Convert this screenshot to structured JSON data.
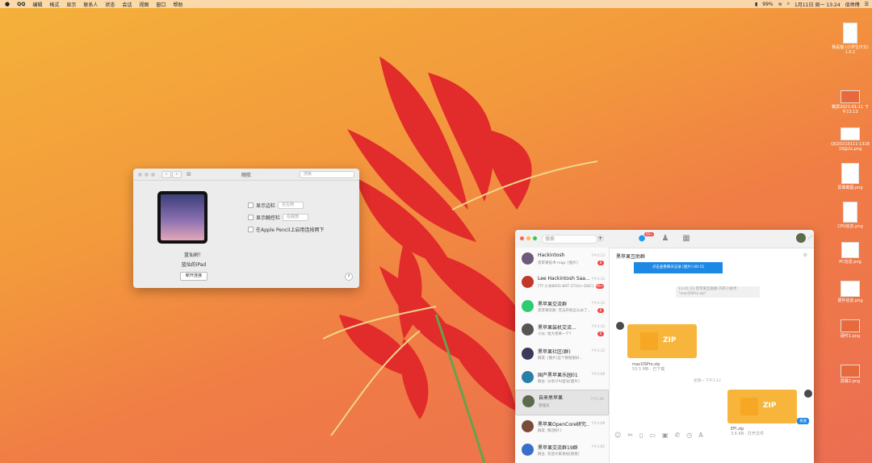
{
  "menubar": {
    "app": "QQ",
    "items": [
      "编辑",
      "格式",
      "显示",
      "联系人",
      "状态",
      "会话",
      "视图",
      "窗口",
      "帮助"
    ],
    "battery": "99%",
    "datetime": "1月11日 周一 13:24",
    "user": "佰师傅"
  },
  "desktop_icons": [
    {
      "label": "我是猫 (小学生作文) 1.0.1"
    },
    {
      "label": "截屏2021-01-11 下午13.13"
    },
    {
      "label": "QQ20210111-1318 19@2x.png"
    },
    {
      "label": "屏幕截图.png"
    },
    {
      "label": "CPU信息.png"
    },
    {
      "label": "PC信息.png"
    },
    {
      "label": "硬件信息.png"
    },
    {
      "label": "硬件1.png"
    },
    {
      "label": "屏幕2.png"
    }
  ],
  "prefs": {
    "title": "随航",
    "search_placeholder": "搜索",
    "device_line1": "蓝仙树！",
    "device_line2": "蓝仙的iPad",
    "disconnect_label": "断开连接",
    "options": [
      {
        "label": "显示边栏",
        "value": "在左侧"
      },
      {
        "label": "显示触控栏",
        "value": "在底部"
      },
      {
        "label": "在Apple Pencil上启用连按两下"
      }
    ],
    "help": "?"
  },
  "qq": {
    "search_placeholder": "搜索",
    "plus": "+",
    "badge": "99+",
    "contacts": [
      {
        "name": "Hackintosh",
        "preview": "黑苹果技术-mqp: [图片]",
        "time": "下午1:13",
        "badge": "8",
        "color": "#6d5a7a"
      },
      {
        "name": "Lee Hackintosh Saa...",
        "preview": "[TF·小米8001·B0T·3710+·DOC]...",
        "time": "下午1:12",
        "badge": "99+",
        "color": "#c0392b"
      },
      {
        "name": "黑苹果交流群",
        "preview": "黑苹果玩家: 无法开机怎么办了...",
        "time": "下午1:12",
        "badge": "8",
        "color": "#2ecc71"
      },
      {
        "name": "黑苹果装机交流...",
        "preview": "小伙: 给大佬来一个?",
        "time": "下午1:12",
        "badge": "6",
        "color": "#555555"
      },
      {
        "name": "黑苹果社区(群)",
        "preview": "群友: [图片]这个教程很好...",
        "time": "下午1:12",
        "badge": "",
        "color": "#3a3a5a"
      },
      {
        "name": "国产黑苹果乐园01",
        "preview": "群主: 分享CPU型号[图片]",
        "time": "下午1:09",
        "badge": "",
        "color": "#2a7fa8"
      },
      {
        "name": "自来黑苹果",
        "preview": "管理员",
        "time": "下午1:09",
        "badge": "",
        "color": "#5b6b4b"
      },
      {
        "name": "黑苹果OpenCore研究...",
        "preview": "群友: 嗯[图片]",
        "time": "下午1:08",
        "badge": "",
        "color": "#7a4b3a"
      },
      {
        "name": "黑苹果交流群19群",
        "preview": "群主: 欢迎大家发帖[链接]",
        "time": "下午1:05",
        "badge": "",
        "color": "#3a6fc8"
      }
    ],
    "chat": {
      "title": "黑苹果互助群",
      "blue_message": "点击查看聊天记录 [图片] 00:15",
      "note": "13:41:23 黑苹果互助群 内存小助手 \"macOSPro.zip\"",
      "file1_name": "macOSPro.zip",
      "file1_meta": "53.5 MB · 已下载",
      "time2": "星期一 下午1:12",
      "file2_name": "EFI.zip",
      "file2_meta": "3.6 KB · 打开文件",
      "zip": "ZIP",
      "send_button": "发送"
    }
  }
}
